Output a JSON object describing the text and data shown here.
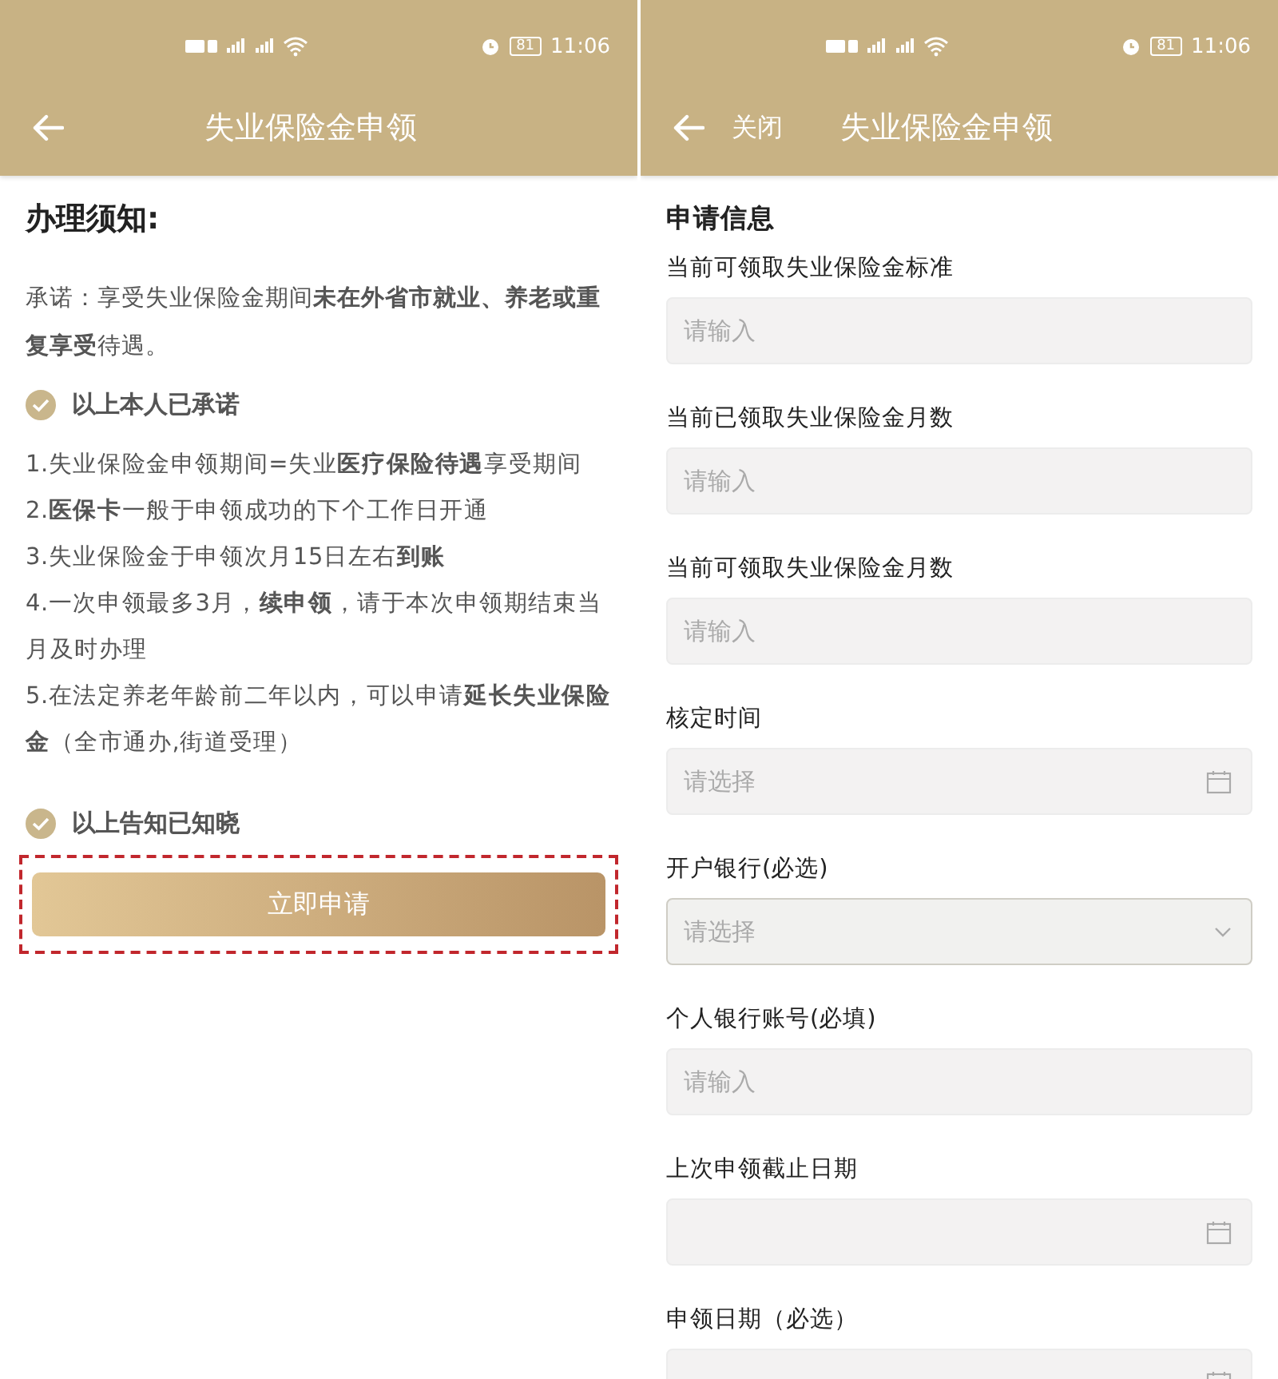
{
  "screens": [
    {
      "kind": "notice",
      "status_bar": {
        "battery": "81",
        "time": "11:06"
      },
      "header": {
        "title": "失业保险金申领"
      },
      "notice_title": "办理须知:",
      "promise": "承诺：享受失业保险金期间**未在外省市就业、养老或重复享受**待遇。",
      "confirm_1": {
        "label": "以上本人已承诺",
        "checked": true
      },
      "items": [
        "1.失业保险金申领期间=失业**医疗保险待遇**享受期间",
        "2.**医保卡**一般于申领成功的下个工作日开通",
        "3.失业保险金于申领次月15日左右**到账**",
        "4.一次申领最多3月，**续申领**，请于本次申领期结束当月及时办理",
        "5.在法定养老年龄前二年以内，可以申请**延长失业保险金**（全市通办,街道受理）"
      ],
      "confirm_2": {
        "label": "以上告知已知晓",
        "checked": true
      },
      "button": {
        "label": "立即申请",
        "highlighted": true
      }
    },
    {
      "kind": "form",
      "status_bar": {
        "battery": "81",
        "time": "11:06"
      },
      "header": {
        "close_label": "关闭",
        "title": "失业保险金申领"
      },
      "section_title": "申请信息",
      "fields": [
        {
          "label": "当前可领取失业保险金标准",
          "kind": "input",
          "placeholder": "请输入",
          "focused": false
        },
        {
          "label": "当前已领取失业保险金月数",
          "kind": "input",
          "placeholder": "请输入",
          "focused": false
        },
        {
          "label": "当前可领取失业保险金月数",
          "kind": "input",
          "placeholder": "请输入",
          "focused": false
        },
        {
          "label": "核定时间",
          "kind": "date",
          "placeholder": "请选择",
          "focused": false
        },
        {
          "label": "开户银行(必选)",
          "kind": "select",
          "placeholder": "请选择",
          "focused": true
        },
        {
          "label": "个人银行账号(必填)",
          "kind": "input",
          "placeholder": "请输入",
          "focused": false
        },
        {
          "label": "上次申领截止日期",
          "kind": "date",
          "focused": false
        },
        {
          "label": "申领日期（必选）",
          "kind": "date",
          "focused": false
        }
      ]
    }
  ]
}
